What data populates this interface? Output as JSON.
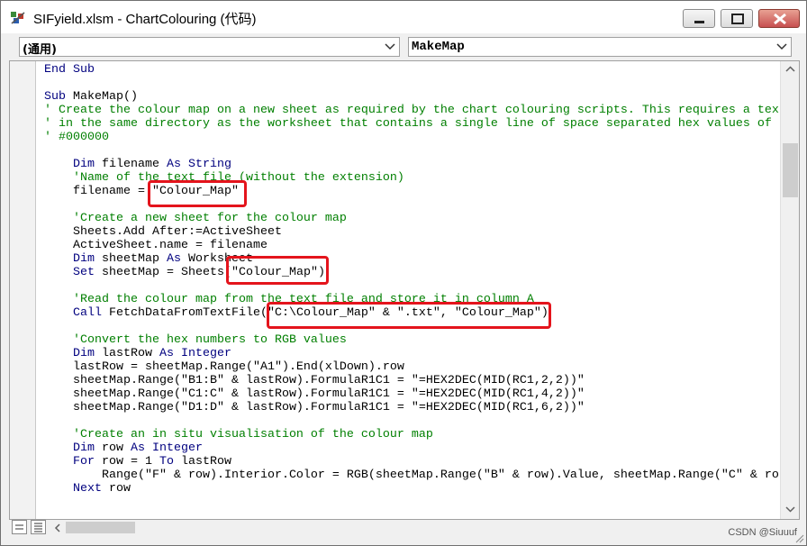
{
  "window": {
    "title": "SIFyield.xlsm - ChartColouring (代码)",
    "icon": "vba-project-icon",
    "buttons": {
      "minimize": "minimize-icon",
      "maximize": "maximize-icon",
      "close": "close-icon"
    }
  },
  "combos": {
    "object": "(通用)",
    "procedure": "MakeMap"
  },
  "code": {
    "lines": [
      {
        "segments": [
          {
            "t": "kw",
            "v": "End Sub"
          }
        ]
      },
      {
        "segments": []
      },
      {
        "segments": [
          {
            "t": "kw",
            "v": "Sub"
          },
          {
            "t": "tx",
            "v": " MakeMap()"
          }
        ]
      },
      {
        "segments": [
          {
            "t": "cm",
            "v": "' Create the colour map on a new sheet as required by the chart colouring scripts. This requires a tex"
          }
        ]
      },
      {
        "segments": [
          {
            "t": "cm",
            "v": "' in the same directory as the worksheet that contains a single line of space separated hex values of"
          }
        ]
      },
      {
        "segments": [
          {
            "t": "cm",
            "v": "' #000000"
          }
        ]
      },
      {
        "segments": []
      },
      {
        "segments": [
          {
            "t": "tx",
            "v": "    "
          },
          {
            "t": "kw",
            "v": "Dim"
          },
          {
            "t": "tx",
            "v": " filename "
          },
          {
            "t": "kw",
            "v": "As String"
          }
        ]
      },
      {
        "segments": [
          {
            "t": "cm",
            "v": "    'Name of the text file (without the extension)"
          }
        ]
      },
      {
        "segments": [
          {
            "t": "tx",
            "v": "    filename = \"Colour_Map\""
          }
        ]
      },
      {
        "segments": []
      },
      {
        "segments": [
          {
            "t": "cm",
            "v": "    'Create a new sheet for the colour map"
          }
        ]
      },
      {
        "segments": [
          {
            "t": "tx",
            "v": "    Sheets.Add After:=ActiveSheet"
          }
        ]
      },
      {
        "segments": [
          {
            "t": "tx",
            "v": "    ActiveSheet.name = filename"
          }
        ]
      },
      {
        "segments": [
          {
            "t": "tx",
            "v": "    "
          },
          {
            "t": "kw",
            "v": "Dim"
          },
          {
            "t": "tx",
            "v": " sheetMap "
          },
          {
            "t": "kw",
            "v": "As"
          },
          {
            "t": "tx",
            "v": " Worksheet"
          }
        ]
      },
      {
        "segments": [
          {
            "t": "tx",
            "v": "    "
          },
          {
            "t": "kw",
            "v": "Set"
          },
          {
            "t": "tx",
            "v": " sheetMap = Sheets(\"Colour_Map\")"
          }
        ]
      },
      {
        "segments": []
      },
      {
        "segments": [
          {
            "t": "cm",
            "v": "    'Read the colour map from the text file and store it in column A"
          }
        ]
      },
      {
        "segments": [
          {
            "t": "tx",
            "v": "    "
          },
          {
            "t": "kw",
            "v": "Call"
          },
          {
            "t": "tx",
            "v": " FetchDataFromTextFile(\"C:\\Colour_Map\" & \".txt\", \"Colour_Map\")"
          }
        ]
      },
      {
        "segments": []
      },
      {
        "segments": [
          {
            "t": "cm",
            "v": "    'Convert the hex numbers to RGB values"
          }
        ]
      },
      {
        "segments": [
          {
            "t": "tx",
            "v": "    "
          },
          {
            "t": "kw",
            "v": "Dim"
          },
          {
            "t": "tx",
            "v": " lastRow "
          },
          {
            "t": "kw",
            "v": "As Integer"
          }
        ]
      },
      {
        "segments": [
          {
            "t": "tx",
            "v": "    lastRow = sheetMap.Range(\"A1\").End(xlDown).row"
          }
        ]
      },
      {
        "segments": [
          {
            "t": "tx",
            "v": "    sheetMap.Range(\"B1:B\" & lastRow).FormulaR1C1 = \"=HEX2DEC(MID(RC1,2,2))\""
          }
        ]
      },
      {
        "segments": [
          {
            "t": "tx",
            "v": "    sheetMap.Range(\"C1:C\" & lastRow).FormulaR1C1 = \"=HEX2DEC(MID(RC1,4,2))\""
          }
        ]
      },
      {
        "segments": [
          {
            "t": "tx",
            "v": "    sheetMap.Range(\"D1:D\" & lastRow).FormulaR1C1 = \"=HEX2DEC(MID(RC1,6,2))\""
          }
        ]
      },
      {
        "segments": []
      },
      {
        "segments": [
          {
            "t": "cm",
            "v": "    'Create an in situ visualisation of the colour map"
          }
        ]
      },
      {
        "segments": [
          {
            "t": "tx",
            "v": "    "
          },
          {
            "t": "kw",
            "v": "Dim"
          },
          {
            "t": "tx",
            "v": " row "
          },
          {
            "t": "kw",
            "v": "As Integer"
          }
        ]
      },
      {
        "segments": [
          {
            "t": "tx",
            "v": "    "
          },
          {
            "t": "kw",
            "v": "For"
          },
          {
            "t": "tx",
            "v": " row = 1 "
          },
          {
            "t": "kw",
            "v": "To"
          },
          {
            "t": "tx",
            "v": " lastRow"
          }
        ]
      },
      {
        "segments": [
          {
            "t": "tx",
            "v": "        Range(\"F\" & row).Interior.Color = RGB(sheetMap.Range(\"B\" & row).Value, sheetMap.Range(\"C\" & ro"
          }
        ]
      },
      {
        "segments": [
          {
            "t": "tx",
            "v": "    "
          },
          {
            "t": "kw",
            "v": "Next"
          },
          {
            "t": "tx",
            "v": " row"
          }
        ]
      }
    ]
  },
  "statusbar": {
    "watermark": "CSDN @Siuuuf"
  },
  "colors": {
    "keyword": "#00007f",
    "comment": "#007f00",
    "highlight": "#e4141c"
  }
}
